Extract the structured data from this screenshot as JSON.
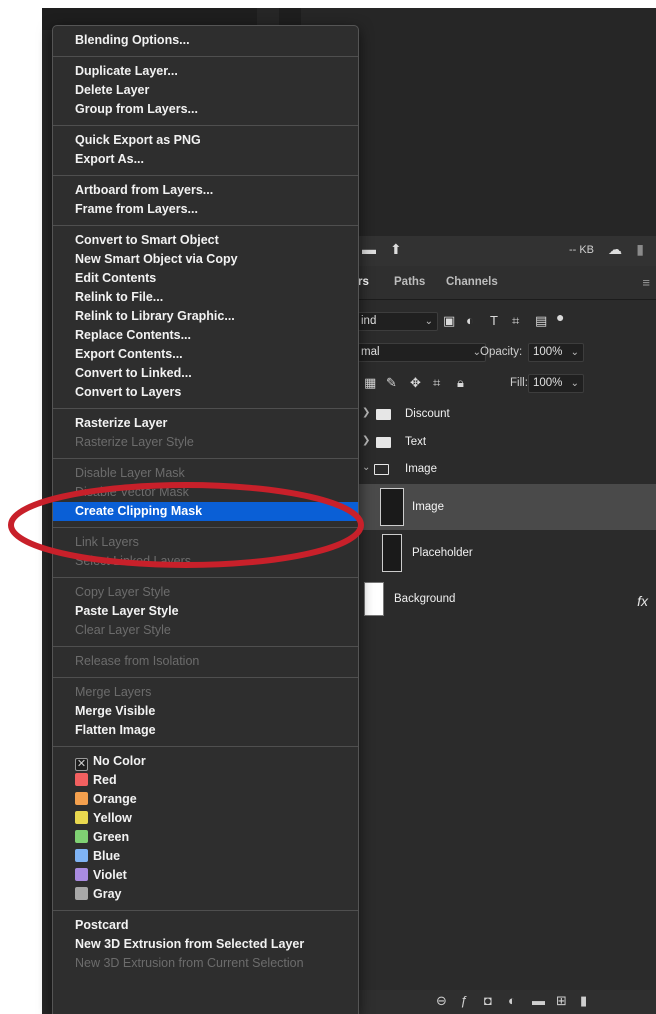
{
  "menu": {
    "groups": [
      {
        "items": [
          {
            "label": "Blending Options...",
            "enabled": true
          }
        ]
      },
      {
        "items": [
          {
            "label": "Duplicate Layer...",
            "enabled": true
          },
          {
            "label": "Delete Layer",
            "enabled": true
          },
          {
            "label": "Group from Layers...",
            "enabled": true
          }
        ]
      },
      {
        "items": [
          {
            "label": "Quick Export as PNG",
            "enabled": true
          },
          {
            "label": "Export As...",
            "enabled": true
          }
        ]
      },
      {
        "items": [
          {
            "label": "Artboard from Layers...",
            "enabled": true
          },
          {
            "label": "Frame from Layers...",
            "enabled": true
          }
        ]
      },
      {
        "items": [
          {
            "label": "Convert to Smart Object",
            "enabled": true
          },
          {
            "label": "New Smart Object via Copy",
            "enabled": true
          },
          {
            "label": "Edit Contents",
            "enabled": true
          },
          {
            "label": "Relink to File...",
            "enabled": true
          },
          {
            "label": "Relink to Library Graphic...",
            "enabled": true
          },
          {
            "label": "Replace Contents...",
            "enabled": true
          },
          {
            "label": "Export Contents...",
            "enabled": true
          },
          {
            "label": "Convert to Linked...",
            "enabled": true
          },
          {
            "label": "Convert to Layers",
            "enabled": true
          }
        ]
      },
      {
        "items": [
          {
            "label": "Rasterize Layer",
            "enabled": true
          },
          {
            "label": "Rasterize Layer Style",
            "enabled": false
          }
        ]
      },
      {
        "items": [
          {
            "label": "Disable Layer Mask",
            "enabled": false
          },
          {
            "label": "Disable Vector Mask",
            "enabled": false
          },
          {
            "label": "Create Clipping Mask",
            "enabled": true,
            "highlighted": true
          }
        ]
      },
      {
        "items": [
          {
            "label": "Link Layers",
            "enabled": false
          },
          {
            "label": "Select Linked Layers",
            "enabled": false
          }
        ]
      },
      {
        "items": [
          {
            "label": "Copy Layer Style",
            "enabled": false
          },
          {
            "label": "Paste Layer Style",
            "enabled": true
          },
          {
            "label": "Clear Layer Style",
            "enabled": false
          }
        ]
      },
      {
        "items": [
          {
            "label": "Release from Isolation",
            "enabled": false
          }
        ]
      },
      {
        "items": [
          {
            "label": "Merge Layers",
            "enabled": false
          },
          {
            "label": "Merge Visible",
            "enabled": true
          },
          {
            "label": "Flatten Image",
            "enabled": true
          }
        ]
      },
      {
        "items": [
          {
            "label": "No Color",
            "enabled": true,
            "swatch": "none"
          },
          {
            "label": "Red",
            "enabled": true,
            "swatch": "#f26060"
          },
          {
            "label": "Orange",
            "enabled": true,
            "swatch": "#f4a04e"
          },
          {
            "label": "Yellow",
            "enabled": true,
            "swatch": "#e9d84f"
          },
          {
            "label": "Green",
            "enabled": true,
            "swatch": "#7fd173"
          },
          {
            "label": "Blue",
            "enabled": true,
            "swatch": "#7fb3f4"
          },
          {
            "label": "Violet",
            "enabled": true,
            "swatch": "#a98be0"
          },
          {
            "label": "Gray",
            "enabled": true,
            "swatch": "#a8a8a8"
          }
        ]
      },
      {
        "items": [
          {
            "label": "Postcard",
            "enabled": true
          },
          {
            "label": "New 3D Extrusion from Selected Layer",
            "enabled": true
          },
          {
            "label": "New 3D Extrusion from Current Selection",
            "enabled": false
          }
        ]
      }
    ]
  },
  "panel": {
    "size_label": "-- KB",
    "tabs": {
      "layers": "rs",
      "paths": "Paths",
      "channels": "Channels"
    },
    "filter_kind": "ind",
    "blend_mode": "mal",
    "opacity_label": "Opacity:",
    "opacity_value": "100%",
    "fill_label": "Fill:",
    "fill_value": "100%",
    "layers": {
      "discount": "Discount",
      "text": "Text",
      "image_group": "Image",
      "image": "Image",
      "placeholder": "Placeholder",
      "background": "Background"
    },
    "fx_label": "fx"
  },
  "colors": {
    "menu_bg": "#2e2e2e",
    "highlight": "#0a5fd6",
    "annotation": "#c8202a"
  }
}
